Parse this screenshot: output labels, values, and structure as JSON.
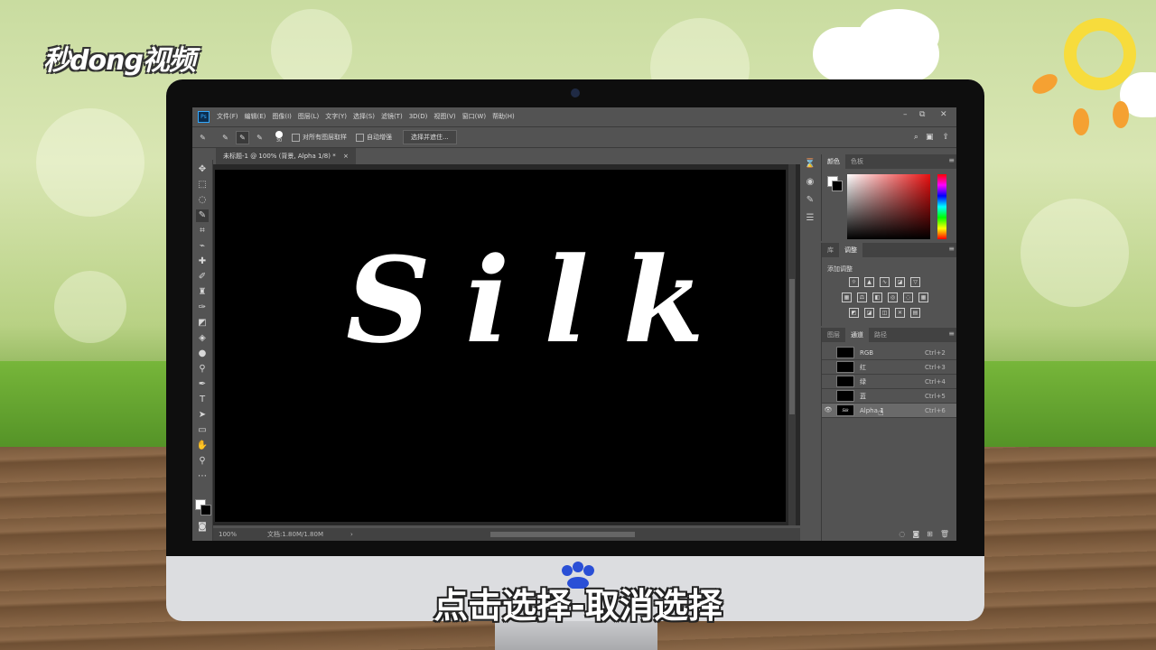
{
  "video": {
    "logo": "秒dong视频",
    "subtitle": "点击选择-取消选择"
  },
  "app": {
    "ps_icon": "Ps",
    "menu": [
      "文件(F)",
      "编辑(E)",
      "图像(I)",
      "图层(L)",
      "文字(Y)",
      "选择(S)",
      "滤镜(T)",
      "3D(D)",
      "视图(V)",
      "窗口(W)",
      "帮助(H)"
    ],
    "window_controls": {
      "minimize": "–",
      "restore": "⧉",
      "close": "✕"
    }
  },
  "options": {
    "brush_size": "30",
    "sample_all_layers": "对所有图层取样",
    "auto_enhance": "自动增强",
    "select_and_mask": "选择并遮住..."
  },
  "document": {
    "tab_title": "未标题-1 @ 100% (背景, Alpha 1/8) *",
    "close": "×",
    "canvas_text": "Silk"
  },
  "status": {
    "zoom": "100%",
    "doc_size": "文档:1.80M/1.80M",
    "arrow": "›"
  },
  "color_panel": {
    "tabs": [
      "颜色",
      "色板"
    ]
  },
  "adjust_panel": {
    "tabs": [
      "库",
      "调整"
    ],
    "title": "添加调整"
  },
  "channels_panel": {
    "tabs": [
      "图层",
      "通道",
      "路径"
    ],
    "channels": [
      {
        "name": "RGB",
        "shortcut": "Ctrl+2",
        "visible": false,
        "selected": false
      },
      {
        "name": "红",
        "shortcut": "Ctrl+3",
        "visible": false,
        "selected": false
      },
      {
        "name": "绿",
        "shortcut": "Ctrl+4",
        "visible": false,
        "selected": false
      },
      {
        "name": "蓝",
        "shortcut": "Ctrl+5",
        "visible": false,
        "selected": false
      },
      {
        "name": "Alpha 1",
        "shortcut": "Ctrl+6",
        "visible": true,
        "selected": true
      }
    ]
  }
}
